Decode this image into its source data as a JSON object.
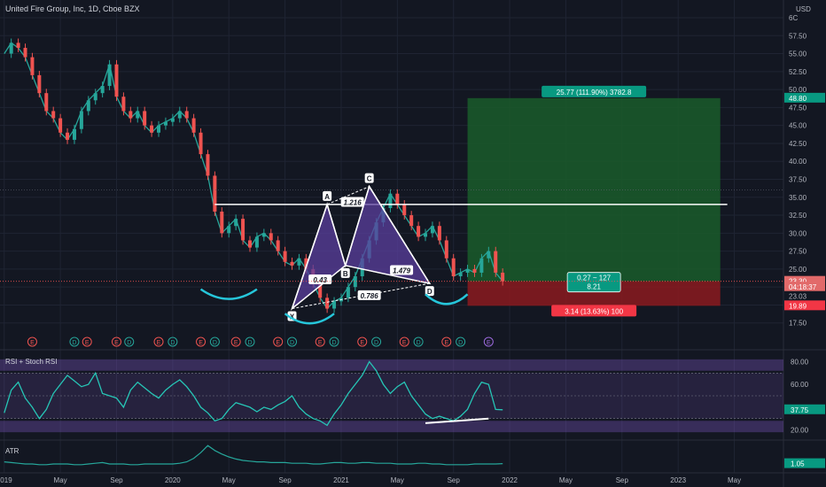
{
  "header": {
    "title": "United Fire Group, Inc, 1D, Cboe BZX",
    "currency": "USD"
  },
  "colors": {
    "background": "#131722",
    "grid": "#1f2433",
    "axis_text": "#b2b5be",
    "candle_up": "#26a69a",
    "candle_down": "#ef5350",
    "pattern_fill": "#5b3f9e",
    "pattern_line": "#ffffff",
    "target_zone": "#1a5c2a",
    "stop_zone": "#8b1a1f",
    "rsi_line": "#26c6b6",
    "atr_line": "#26a69a",
    "target_badge": "#089981",
    "stop_badge": "#f23645",
    "price_badge": "#e26a6a"
  },
  "chart_data": [
    {
      "type": "line",
      "title": "United Fire Group, Inc, 1D, Cboe BZX",
      "ylabel": "USD",
      "ylim": [
        15,
        60
      ],
      "ytick_labels": [
        "17.50",
        "20.00",
        "22.50",
        "25.00",
        "27.50",
        "30.00",
        "32.50",
        "35.00",
        "37.50",
        "40.00",
        "42.50",
        "45.00",
        "47.50",
        "50.00",
        "52.50",
        "55.00",
        "57.50",
        "6C"
      ],
      "yticks": [
        17.5,
        20,
        22.5,
        25,
        27.5,
        30,
        32.5,
        35,
        37.5,
        40,
        42.5,
        45,
        47.5,
        50,
        52.5,
        55,
        57.5,
        60
      ],
      "x_tick_labels": [
        "2019",
        "May",
        "Sep",
        "2020",
        "May",
        "Sep",
        "2021",
        "May",
        "Sep",
        "2022",
        "May",
        "Sep",
        "2023",
        "May"
      ],
      "x_tick_months": [
        0,
        4,
        8,
        12,
        16,
        20,
        24,
        28,
        32,
        36,
        40,
        44,
        48,
        52
      ],
      "series": [
        {
          "values": [
            55.0,
            56.5,
            55.8,
            54.5,
            52.0,
            49.5,
            47.0,
            46.0,
            44.0,
            43.0,
            44.5,
            47.0,
            48.5,
            49.5,
            50.5,
            53.5,
            49.0,
            47.0,
            46.0,
            47.0,
            45.0,
            44.0,
            45.0,
            45.5,
            46.0,
            47.0,
            46.0,
            44.0,
            41.0,
            38.0,
            33.0,
            30.0,
            31.0,
            32.0,
            29.0,
            28.0,
            29.5,
            30.0,
            29.0,
            27.5,
            26.0,
            25.5,
            26.5,
            25.0,
            23.0,
            21.0,
            19.5,
            20.5,
            21.0,
            22.5,
            24.0,
            26.5,
            29.0,
            31.5,
            33.5,
            35.5,
            34.0,
            32.5,
            31.0,
            29.5,
            30.0,
            31.0,
            29.0,
            26.5,
            24.0,
            24.5,
            25.0,
            24.5,
            26.5,
            27.5,
            24.5,
            23.3
          ],
          "start_month": 0,
          "step_months": 0.5
        }
      ],
      "pattern_points": [
        {
          "label": "X",
          "month": 20.5,
          "value": 19.5
        },
        {
          "label": "A",
          "month": 23.0,
          "value": 34.0
        },
        {
          "label": "B",
          "month": 24.3,
          "value": 25.5
        },
        {
          "label": "C",
          "month": 26.0,
          "value": 36.5
        },
        {
          "label": "D",
          "month": 30.3,
          "value": 23.0
        }
      ],
      "ratio_labels": [
        {
          "text": "1.216",
          "month": 24.8,
          "value": 34.3
        },
        {
          "text": "0.43",
          "month": 22.5,
          "value": 23.5
        },
        {
          "text": "1.479",
          "month": 28.3,
          "value": 24.8
        },
        {
          "text": "0.786",
          "month": 26.0,
          "value": 21.3
        }
      ],
      "resistance": {
        "value": 34.0,
        "from_month": 15.0,
        "to_month": 51.5
      },
      "position": {
        "entry": 23.3,
        "target": 48.8,
        "stop": 19.89,
        "from_month": 33.0,
        "to_month": 51.0,
        "target_label": "25.77 (111.90%) 3782.8",
        "stop_label": "3.14 (13.63%) 100",
        "mid_label_1": "0.27 ~ 127",
        "mid_label_2": "8.21"
      },
      "price_badges": [
        {
          "text": "48.80",
          "value": 48.8,
          "kind": "target"
        },
        {
          "text": "23.30",
          "value": 23.3,
          "kind": "price"
        },
        {
          "text": "04:18:37",
          "value": 22.5,
          "kind": "price_sub"
        },
        {
          "text": "23.03",
          "value": 21.2,
          "kind": "plain"
        },
        {
          "text": "19.89",
          "value": 19.89,
          "kind": "stop"
        }
      ],
      "earnings_markers": [
        {
          "text": "E",
          "month": 2.0,
          "kind": "red"
        },
        {
          "text": "D",
          "month": 5.0,
          "kind": "teal"
        },
        {
          "text": "E",
          "month": 5.9,
          "kind": "red"
        },
        {
          "text": "E",
          "month": 8.0,
          "kind": "red"
        },
        {
          "text": "D",
          "month": 8.9,
          "kind": "teal"
        },
        {
          "text": "E",
          "month": 11.0,
          "kind": "red"
        },
        {
          "text": "D",
          "month": 12.0,
          "kind": "teal"
        },
        {
          "text": "E",
          "month": 14.0,
          "kind": "red"
        },
        {
          "text": "D",
          "month": 15.0,
          "kind": "teal"
        },
        {
          "text": "E",
          "month": 16.5,
          "kind": "red"
        },
        {
          "text": "D",
          "month": 17.5,
          "kind": "teal"
        },
        {
          "text": "E",
          "month": 19.5,
          "kind": "red"
        },
        {
          "text": "D",
          "month": 20.5,
          "kind": "teal"
        },
        {
          "text": "E",
          "month": 22.5,
          "kind": "red"
        },
        {
          "text": "D",
          "month": 23.5,
          "kind": "teal"
        },
        {
          "text": "E",
          "month": 25.5,
          "kind": "red"
        },
        {
          "text": "D",
          "month": 26.5,
          "kind": "teal"
        },
        {
          "text": "E",
          "month": 28.5,
          "kind": "red"
        },
        {
          "text": "D",
          "month": 29.5,
          "kind": "teal"
        },
        {
          "text": "E",
          "month": 31.5,
          "kind": "red"
        },
        {
          "text": "D",
          "month": 32.5,
          "kind": "teal"
        },
        {
          "text": "E",
          "month": 34.5,
          "kind": "purple"
        }
      ]
    },
    {
      "type": "line",
      "title": "RSI + Stoch RSI",
      "ylim": [
        15,
        85
      ],
      "ytick_labels": [
        "20.00",
        "40.00",
        "60.00",
        "80.00"
      ],
      "yticks": [
        20,
        40,
        60,
        80
      ],
      "band": [
        30,
        70
      ],
      "current_label": "37.75",
      "series": [
        {
          "values": [
            35,
            55,
            62,
            48,
            40,
            30,
            38,
            52,
            60,
            68,
            63,
            58,
            60,
            70,
            52,
            50,
            48,
            40,
            55,
            62,
            57,
            52,
            48,
            55,
            60,
            64,
            58,
            50,
            40,
            35,
            28,
            30,
            38,
            44,
            42,
            40,
            36,
            40,
            38,
            42,
            45,
            50,
            40,
            34,
            30,
            28,
            24,
            34,
            42,
            52,
            60,
            68,
            80,
            72,
            60,
            52,
            58,
            62,
            50,
            42,
            34,
            30,
            32,
            30,
            28,
            32,
            38,
            52,
            62,
            60,
            38,
            37.75
          ],
          "start_month": 0,
          "step_months": 0.5
        }
      ],
      "divergence_line": {
        "from_month": 30.0,
        "from_value": 26,
        "to_month": 34.5,
        "to_value": 30
      }
    },
    {
      "type": "line",
      "title": "ATR",
      "ylim": [
        0,
        4
      ],
      "current_label": "1.05",
      "series": [
        {
          "values": [
            1.3,
            1.2,
            1.1,
            1.0,
            1.0,
            0.9,
            0.9,
            1.0,
            1.0,
            1.0,
            0.9,
            0.9,
            1.0,
            1.1,
            1.2,
            1.0,
            1.0,
            1.0,
            0.9,
            0.9,
            1.0,
            1.0,
            1.0,
            1.0,
            1.0,
            1.1,
            1.3,
            1.8,
            2.6,
            3.6,
            2.9,
            2.4,
            2.0,
            1.7,
            1.5,
            1.4,
            1.3,
            1.3,
            1.2,
            1.2,
            1.2,
            1.1,
            1.1,
            1.1,
            1.0,
            1.0,
            1.1,
            1.2,
            1.2,
            1.1,
            1.1,
            1.2,
            1.2,
            1.1,
            1.1,
            1.1,
            1.0,
            1.0,
            1.0,
            1.1,
            1.1,
            1.0,
            1.0,
            0.9,
            0.9,
            0.9,
            0.9,
            1.0,
            1.0,
            1.0,
            1.0,
            1.05
          ],
          "start_month": 0,
          "step_months": 0.5
        }
      ]
    }
  ]
}
